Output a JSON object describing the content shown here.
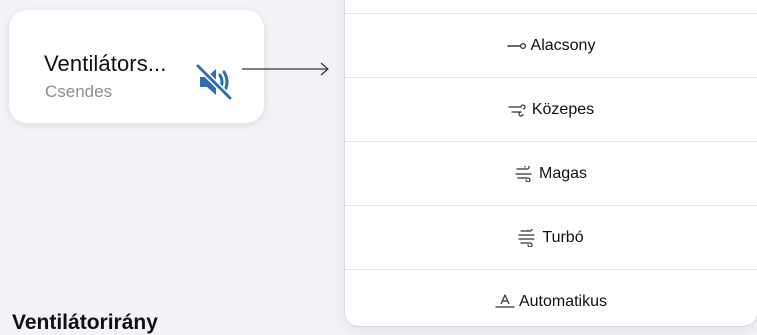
{
  "tile": {
    "title": "Ventilátors...",
    "subtitle": "Csendes",
    "icon": "speaker-muted-icon",
    "icon_color": "#2f6db5"
  },
  "menu": {
    "items": [
      {
        "label": "Alacsony",
        "icon": "fan-low-icon"
      },
      {
        "label": "Közepes",
        "icon": "fan-medium-icon"
      },
      {
        "label": "Magas",
        "icon": "fan-high-icon"
      },
      {
        "label": "Turbó",
        "icon": "fan-turbo-icon"
      },
      {
        "label": "Automatikus",
        "icon": "fan-auto-icon"
      }
    ]
  },
  "section": {
    "title": "Ventilátorirány"
  }
}
